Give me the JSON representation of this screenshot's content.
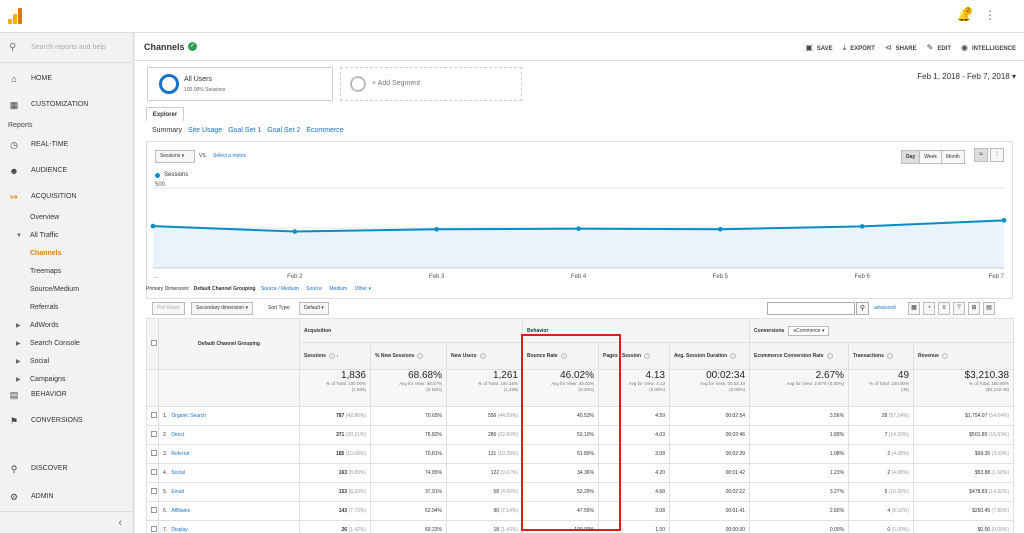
{
  "colors": {
    "accent": "#f37c00",
    "link": "#1a73c8",
    "series": "#058dc7",
    "area": "#e8f3fb",
    "highlight": "#e01b1b",
    "verified": "#2e9e4f"
  },
  "topbar": {
    "notification_count": "2"
  },
  "sidebar": {
    "search_placeholder": "Search reports and help",
    "home": "HOME",
    "customization": "CUSTOMIZATION",
    "reports_label": "Reports",
    "realtime": "REAL-TIME",
    "audience": "AUDIENCE",
    "acquisition": "ACQUISITION",
    "overview": "Overview",
    "all_traffic": "All Traffic",
    "channels": "Channels",
    "treemaps": "Treemaps",
    "source_medium": "Source/Medium",
    "referrals": "Referrals",
    "adwords": "AdWords",
    "search_console": "Search Console",
    "social": "Social",
    "campaigns": "Campaigns",
    "behavior": "BEHAVIOR",
    "conversions": "CONVERSIONS",
    "discover": "DISCOVER",
    "admin": "ADMIN"
  },
  "header": {
    "title": "Channels",
    "save": "SAVE",
    "export": "EXPORT",
    "share": "SHARE",
    "edit": "EDIT",
    "intelligence": "INTELLIGENCE"
  },
  "segments": {
    "all_users": "All Users",
    "all_users_sub": "100.00% Sessions",
    "add": "+ Add Segment"
  },
  "date_range": "Feb 1, 2018 - Feb 7, 2018",
  "explorer": {
    "tab": "Explorer",
    "subtabs": [
      "Summary",
      "Site Usage",
      "Goal Set 1",
      "Goal Set 2",
      "Ecommerce"
    ]
  },
  "chart_controls": {
    "metric": "Sessions",
    "vs": "VS.",
    "select_metric": "Select a metric",
    "day": "Day",
    "week": "Week",
    "month": "Month",
    "legend": "Sessions"
  },
  "chart_data": {
    "type": "line",
    "x": [
      "...",
      "Feb 2",
      "Feb 3",
      "Feb 4",
      "Feb 5",
      "Feb 6",
      "Feb 7"
    ],
    "series": [
      {
        "name": "Sessions",
        "values": [
          262,
          228,
          242,
          246,
          242,
          260,
          298
        ]
      }
    ],
    "ylim": [
      0,
      500
    ],
    "yticks": [
      "500",
      "250"
    ],
    "grid": true,
    "legend": "top-left"
  },
  "dimensions": {
    "primary_label": "Primary Dimension:",
    "current": "Default Channel Grouping",
    "options": [
      "Source / Medium",
      "Source",
      "Medium",
      "Other ▾"
    ]
  },
  "table_tools": {
    "plot_rows": "Plot Rows",
    "secondary": "Secondary dimension ▾",
    "sort_label": "Sort Type:",
    "sort_value": "Default ▾",
    "advanced": "advanced"
  },
  "table": {
    "group_headers": {
      "acquisition": "Acquisition",
      "behavior": "Behavior",
      "conversions": "Conversions",
      "conv_select": "eCommerce ▾"
    },
    "dim_header": "Default Channel Grouping",
    "columns": [
      "Sessions",
      "% New Sessions",
      "New Users",
      "Bounce Rate",
      "Pages / Session",
      "Avg. Session Duration",
      "Ecommerce Conversion Rate",
      "Transactions",
      "Revenue"
    ],
    "totals": [
      {
        "big": "1,836",
        "sm1": "% of Total: 100.00%",
        "sm2": "(1,836)"
      },
      {
        "big": "68.68%",
        "sm1": "Avg for View: 68.57%",
        "sm2": "(0.16%)"
      },
      {
        "big": "1,261",
        "sm1": "% of Total: 100.16%",
        "sm2": "(1,259)"
      },
      {
        "big": "46.02%",
        "sm1": "Avg for View: 46.02%",
        "sm2": "(0.00%)"
      },
      {
        "big": "4.13",
        "sm1": "Avg for View: 4.13",
        "sm2": "(0.00%)"
      },
      {
        "big": "00:02:34",
        "sm1": "Avg for View: 00:02:34",
        "sm2": "(0.00%)"
      },
      {
        "big": "2.67%",
        "sm1": "Avg for View: 2.67% (0.00%)",
        "sm2": ""
      },
      {
        "big": "49",
        "sm1": "% of Total: 100.00%",
        "sm2": "(49)"
      },
      {
        "big": "$3,210.38",
        "sm1": "% of Total: 100.00%",
        "sm2": "($3,210.38)"
      }
    ],
    "rows": [
      {
        "n": "1.",
        "name": "Organic Search",
        "sessions": "787",
        "sessions_pct": "(42.86%)",
        "new_sess": "70.65%",
        "new_users": "556",
        "new_users_pct": "(44.09%)",
        "bounce": "40.53%",
        "pages": "4.59",
        "dur": "00:02:54",
        "conv": "3.56%",
        "trans": "28",
        "trans_pct": "(57.14%)",
        "rev": "$1,754.07",
        "rev_pct": "(54.64%)"
      },
      {
        "n": "2.",
        "name": "Direct",
        "sessions": "371",
        "sessions_pct": "(20.21%)",
        "new_sess": "76.82%",
        "new_users": "285",
        "new_users_pct": "(22.60%)",
        "bounce": "53.10%",
        "pages": "4.03",
        "dur": "00:02:46",
        "conv": "1.89%",
        "trans": "7",
        "trans_pct": "(14.29%)",
        "rev": "$501.80",
        "rev_pct": "(15.63%)"
      },
      {
        "n": "3.",
        "name": "Referral",
        "sessions": "185",
        "sessions_pct": "(10.08%)",
        "new_sess": "70.81%",
        "new_users": "131",
        "new_users_pct": "(10.39%)",
        "bounce": "51.89%",
        "pages": "3.08",
        "dur": "00:02:39",
        "conv": "1.08%",
        "trans": "2",
        "trans_pct": "(4.08%)",
        "rev": "$99.35",
        "rev_pct": "(3.09%)"
      },
      {
        "n": "4.",
        "name": "Social",
        "sessions": "163",
        "sessions_pct": "(8.88%)",
        "new_sess": "74.85%",
        "new_users": "122",
        "new_users_pct": "(9.67%)",
        "bounce": "34.36%",
        "pages": "4.20",
        "dur": "00:01:42",
        "conv": "1.23%",
        "trans": "2",
        "trans_pct": "(4.08%)",
        "rev": "$53.88",
        "rev_pct": "(1.68%)"
      },
      {
        "n": "5.",
        "name": "Email",
        "sessions": "153",
        "sessions_pct": "(8.33%)",
        "new_sess": "37.91%",
        "new_users": "58",
        "new_users_pct": "(4.60%)",
        "bounce": "52.29%",
        "pages": "4.68",
        "dur": "00:02:22",
        "conv": "3.27%",
        "trans": "5",
        "trans_pct": "(10.20%)",
        "rev": "$478.83",
        "rev_pct": "(14.92%)"
      },
      {
        "n": "6.",
        "name": "Affiliates",
        "sessions": "143",
        "sessions_pct": "(7.79%)",
        "new_sess": "62.94%",
        "new_users": "90",
        "new_users_pct": "(7.14%)",
        "bounce": "47.55%",
        "pages": "3.08",
        "dur": "00:01:41",
        "conv": "2.80%",
        "trans": "4",
        "trans_pct": "(8.16%)",
        "rev": "$250.45",
        "rev_pct": "(7.80%)"
      },
      {
        "n": "7.",
        "name": "Display",
        "sessions": "26",
        "sessions_pct": "(1.42%)",
        "new_sess": "69.23%",
        "new_users": "18",
        "new_users_pct": "(1.43%)",
        "bounce": "100.00%",
        "pages": "1.00",
        "dur": "00:00:00",
        "conv": "0.00%",
        "trans": "0",
        "trans_pct": "(0.00%)",
        "rev": "$0.00",
        "rev_pct": "(0.00%)"
      }
    ]
  }
}
